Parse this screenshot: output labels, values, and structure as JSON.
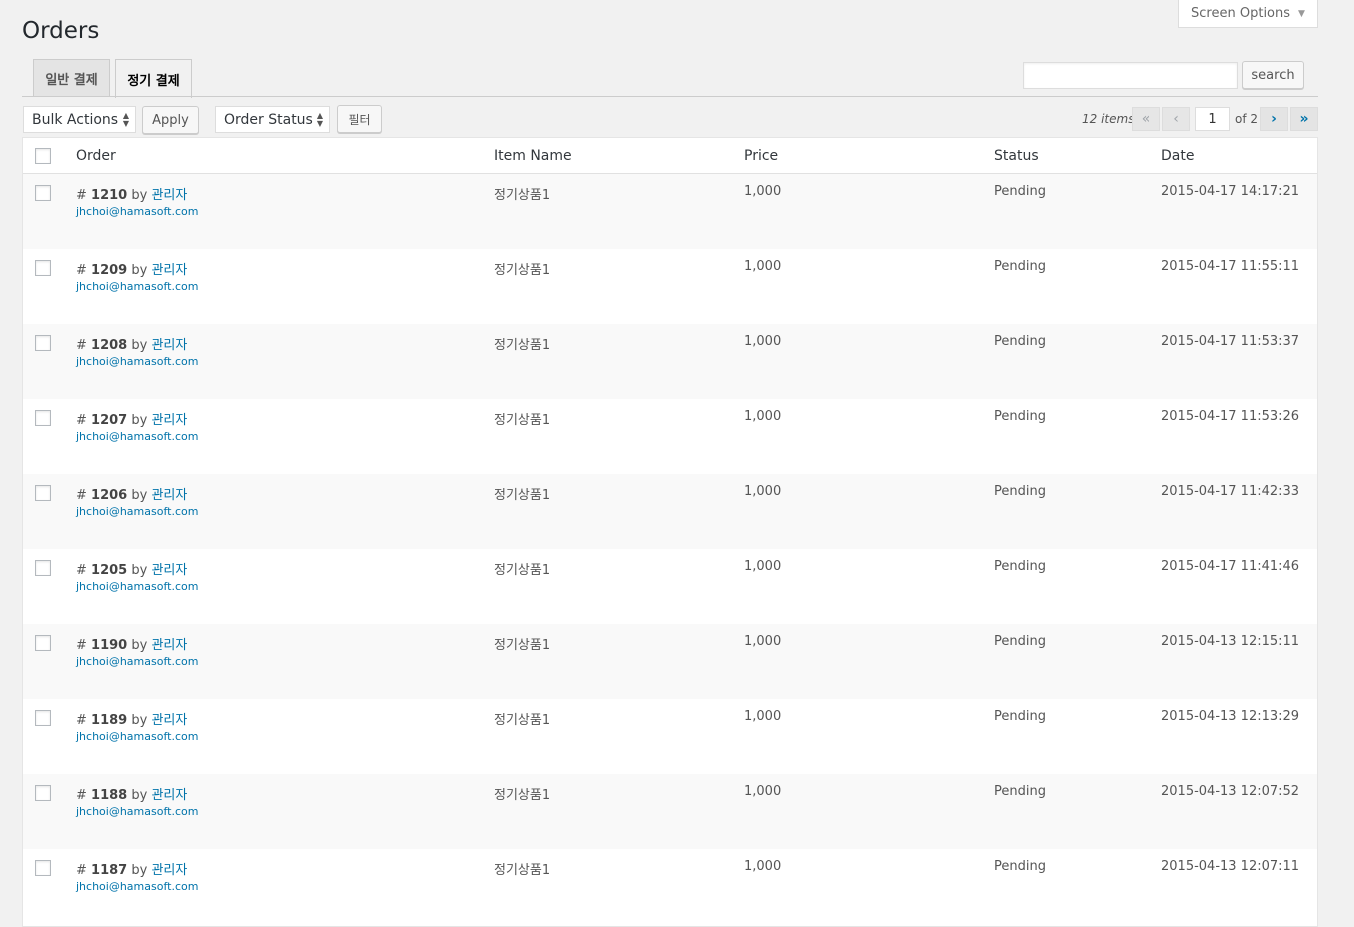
{
  "screen_options": {
    "label": "Screen Options"
  },
  "page": {
    "title": "Orders"
  },
  "tabs": [
    {
      "label": "일반 결제",
      "active": false
    },
    {
      "label": "정기 결제",
      "active": true
    }
  ],
  "search": {
    "button": "search",
    "value": ""
  },
  "toolbar": {
    "bulk_actions": "Bulk Actions",
    "apply": "Apply",
    "order_status": "Order Status",
    "filter": "필터"
  },
  "pagination": {
    "items": "12 items",
    "first": "«",
    "prev": "‹",
    "current": "1",
    "of": "of 2",
    "next": "›",
    "last": "»"
  },
  "columns": {
    "order": "Order",
    "item_name": "Item Name",
    "price": "Price",
    "status": "Status",
    "date": "Date"
  },
  "rows": [
    {
      "hash": "#",
      "id": "1210",
      "by": "by",
      "user": "관리자",
      "email": "jhchoi@hamasoft.com",
      "item": "정기상품1",
      "price": "1,000",
      "status": "Pending",
      "date": "2015-04-17 14:17:21"
    },
    {
      "hash": "#",
      "id": "1209",
      "by": "by",
      "user": "관리자",
      "email": "jhchoi@hamasoft.com",
      "item": "정기상품1",
      "price": "1,000",
      "status": "Pending",
      "date": "2015-04-17 11:55:11"
    },
    {
      "hash": "#",
      "id": "1208",
      "by": "by",
      "user": "관리자",
      "email": "jhchoi@hamasoft.com",
      "item": "정기상품1",
      "price": "1,000",
      "status": "Pending",
      "date": "2015-04-17 11:53:37"
    },
    {
      "hash": "#",
      "id": "1207",
      "by": "by",
      "user": "관리자",
      "email": "jhchoi@hamasoft.com",
      "item": "정기상품1",
      "price": "1,000",
      "status": "Pending",
      "date": "2015-04-17 11:53:26"
    },
    {
      "hash": "#",
      "id": "1206",
      "by": "by",
      "user": "관리자",
      "email": "jhchoi@hamasoft.com",
      "item": "정기상품1",
      "price": "1,000",
      "status": "Pending",
      "date": "2015-04-17 11:42:33"
    },
    {
      "hash": "#",
      "id": "1205",
      "by": "by",
      "user": "관리자",
      "email": "jhchoi@hamasoft.com",
      "item": "정기상품1",
      "price": "1,000",
      "status": "Pending",
      "date": "2015-04-17 11:41:46"
    },
    {
      "hash": "#",
      "id": "1190",
      "by": "by",
      "user": "관리자",
      "email": "jhchoi@hamasoft.com",
      "item": "정기상품1",
      "price": "1,000",
      "status": "Pending",
      "date": "2015-04-13 12:15:11"
    },
    {
      "hash": "#",
      "id": "1189",
      "by": "by",
      "user": "관리자",
      "email": "jhchoi@hamasoft.com",
      "item": "정기상품1",
      "price": "1,000",
      "status": "Pending",
      "date": "2015-04-13 12:13:29"
    },
    {
      "hash": "#",
      "id": "1188",
      "by": "by",
      "user": "관리자",
      "email": "jhchoi@hamasoft.com",
      "item": "정기상품1",
      "price": "1,000",
      "status": "Pending",
      "date": "2015-04-13 12:07:52"
    },
    {
      "hash": "#",
      "id": "1187",
      "by": "by",
      "user": "관리자",
      "email": "jhchoi@hamasoft.com",
      "item": "정기상품1",
      "price": "1,000",
      "status": "Pending",
      "date": "2015-04-13 12:07:11"
    }
  ]
}
